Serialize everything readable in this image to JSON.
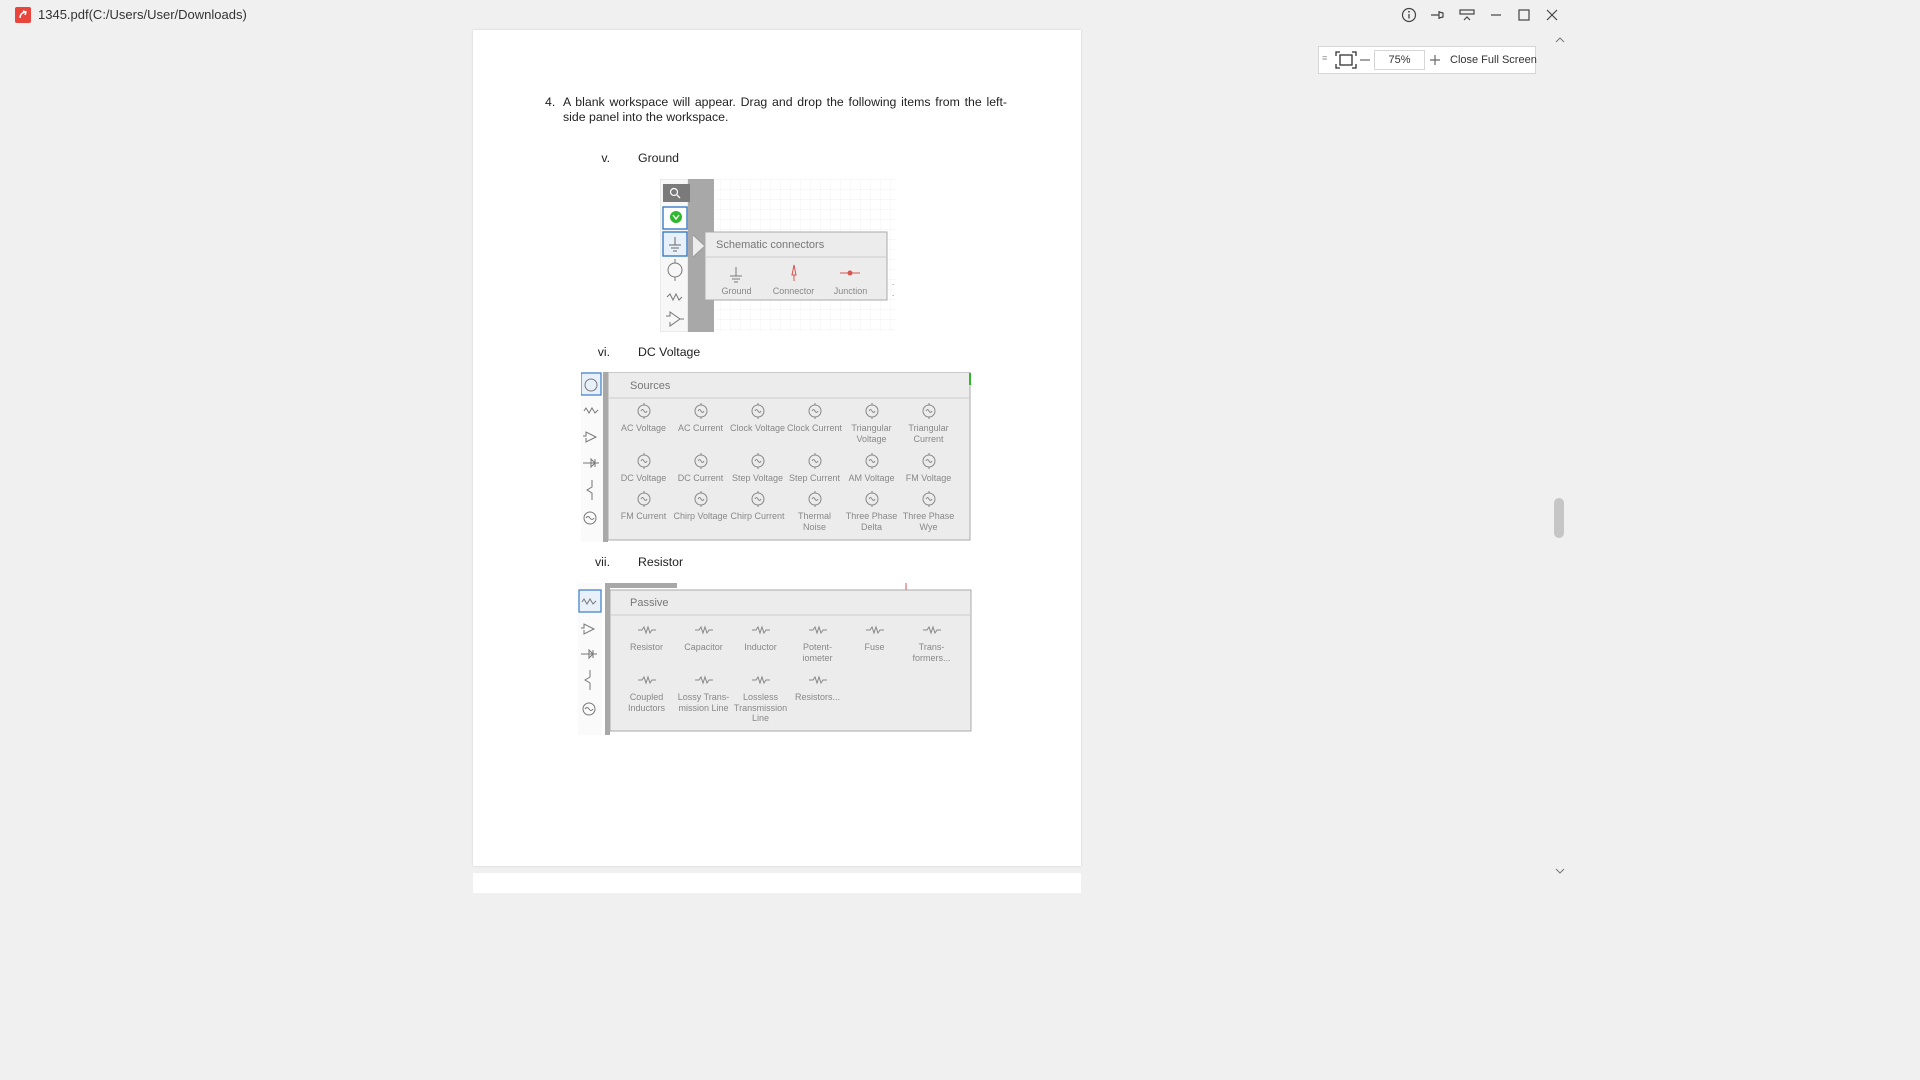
{
  "window": {
    "title": "1345.pdf(C:/Users/User/Downloads)"
  },
  "document": {
    "step_number": "4.",
    "step_text": "A blank workspace will appear. Drag and drop the following items from the left-side panel into the workspace.",
    "items": [
      {
        "roman": "v.",
        "label": "Ground"
      },
      {
        "roman": "vi.",
        "label": "DC Voltage"
      },
      {
        "roman": "vii.",
        "label": "Resistor"
      }
    ]
  },
  "figures": {
    "schematic": {
      "title": "Schematic connectors",
      "components": [
        "Ground",
        "Connector",
        "Junction"
      ]
    },
    "sources": {
      "title": "Sources",
      "components": [
        [
          "AC Voltage",
          "AC Current",
          "Clock Voltage",
          "Clock Current",
          "Triangular Voltage",
          "Triangular Current"
        ],
        [
          "DC Voltage",
          "DC Current",
          "Step Voltage",
          "Step Current",
          "AM Voltage",
          "FM Voltage"
        ],
        [
          "FM Current",
          "Chirp Voltage",
          "Chirp Current",
          "Thermal Noise",
          "Three Phase Delta",
          "Three Phase Wye"
        ]
      ]
    },
    "passive": {
      "title": "Passive",
      "components": [
        [
          "Resistor",
          "Capacitor",
          "Inductor",
          "Potent-iometer",
          "Fuse",
          "Trans-formers..."
        ],
        [
          "Coupled Inductors",
          "Lossy Trans-mission Line",
          "Lossless Transmission Line",
          "Resistors..."
        ]
      ]
    }
  },
  "viewer_toolbar": {
    "zoom": "75%",
    "close_fullscreen_label": "Close Full Screen"
  },
  "colors": {
    "pdf_icon": "#e8453c",
    "panel_bg": "#ececec",
    "sidebar_gray": "#a8a8a8",
    "accent_blue": "#3a7bc8",
    "badge_green": "#2eb82e"
  }
}
